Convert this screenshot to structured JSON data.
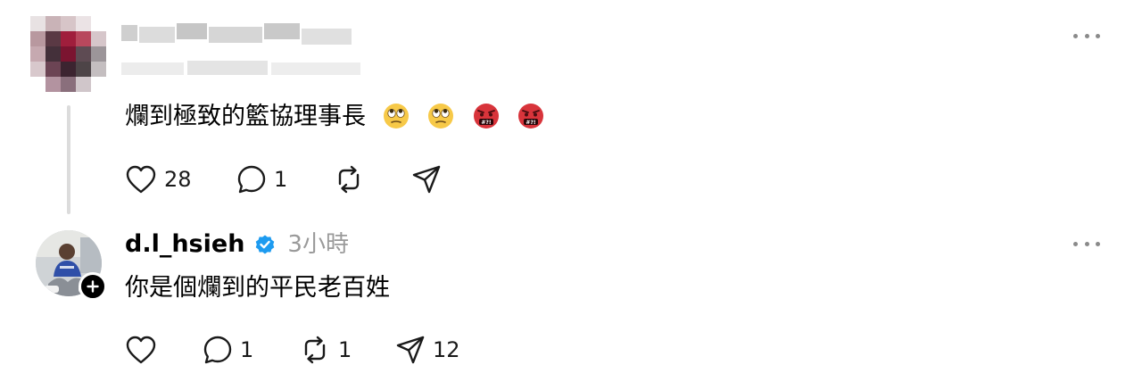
{
  "comments": [
    {
      "username": "",
      "time": "",
      "text": "爛到極致的籃協理事長",
      "emojis": [
        "face-with-rolling-eyes",
        "face-with-rolling-eyes",
        "face-with-symbols-on-mouth",
        "face-with-symbols-on-mouth"
      ],
      "likes": "28",
      "replies": "1",
      "reposts": "",
      "shares": ""
    },
    {
      "username": "d.l_hsieh",
      "verified": true,
      "time": "3小時",
      "text": "你是個爛到的平民老百姓",
      "likes": "",
      "replies": "1",
      "reposts": "1",
      "shares": "12"
    }
  ],
  "colors": {
    "verified": "#1d9bf0",
    "muted": "#9a9a9a",
    "icon": "#1a1a1a"
  },
  "icons": [
    "heart-icon",
    "comment-icon",
    "repost-icon",
    "share-icon",
    "more-icon",
    "verified-badge-icon",
    "plus-icon"
  ]
}
